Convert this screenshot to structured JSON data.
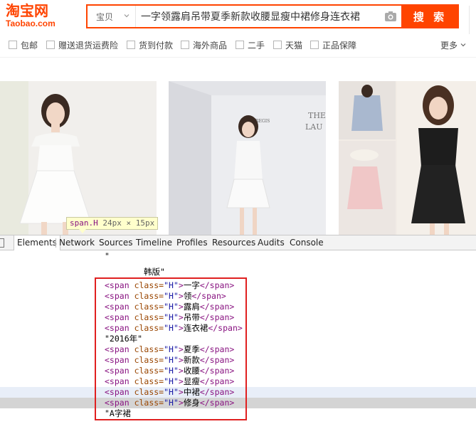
{
  "logo": {
    "cn": "淘宝网",
    "en": "Taobao.com"
  },
  "search": {
    "category": "宝贝",
    "query": "一字领露肩吊带夏季新款收腰显瘦中裙修身连衣裙",
    "button": "搜 索"
  },
  "filters": {
    "items": [
      "包邮",
      "赠送退货运费险",
      "货到付款",
      "海外商品",
      "二手",
      "天猫",
      "正品保障"
    ],
    "more": "更多"
  },
  "tooltip": {
    "selector": "span.H",
    "size": "24px × 15px"
  },
  "devtools": {
    "tabs": [
      "Elements",
      "Network",
      "Sources",
      "Timeline",
      "Profiles",
      "Resources",
      "Audits",
      "Console"
    ],
    "active_tab": "Elements",
    "code": {
      "quote_open": "\"",
      "text_korean": "韩版\"",
      "span_open": "<span",
      "attr_name": "class=",
      "attr_value": "\"H\"",
      "span_close": "</span>",
      "span_words_1": [
        "一字",
        "领",
        "露肩",
        "吊带",
        "连衣裙"
      ],
      "text_year": "\"2016年\"",
      "span_words_2": [
        "夏季",
        "新款",
        "收腰",
        "显瘦",
        "中裙",
        "修身"
      ],
      "text_end": "\"A字裙"
    }
  },
  "colors": {
    "brand": "#ff4400",
    "redbox": "#e02020"
  }
}
